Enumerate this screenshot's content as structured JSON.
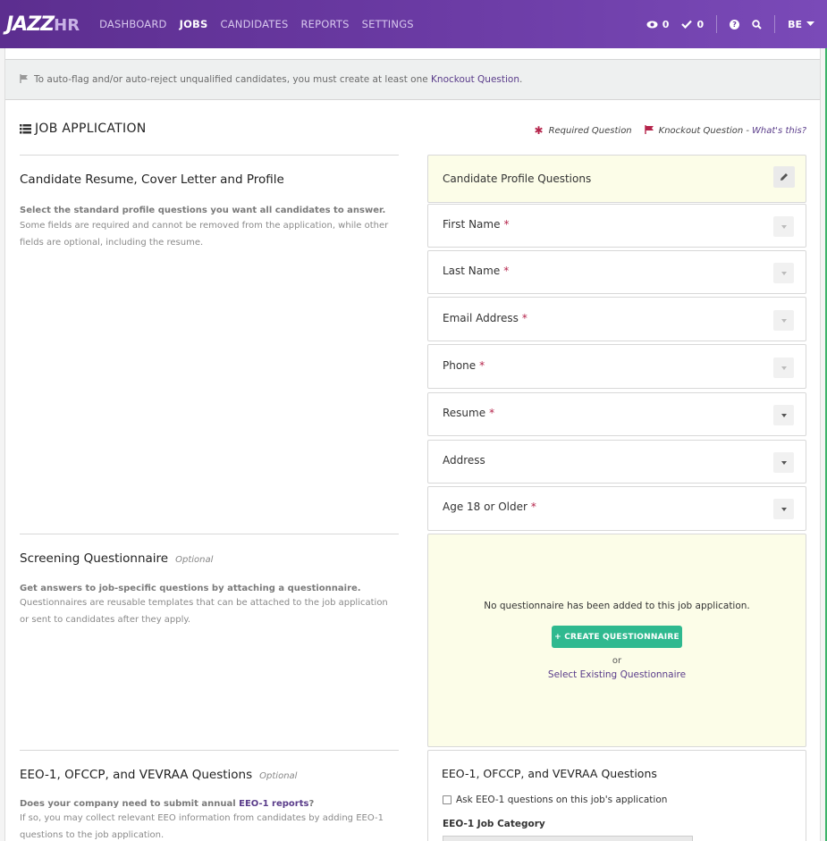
{
  "nav": {
    "logo_main": "JAZZ",
    "logo_hr": "HR",
    "links": [
      "DASHBOARD",
      "JOBS",
      "CANDIDATES",
      "REPORTS",
      "SETTINGS"
    ],
    "active": "JOBS",
    "views_count": "0",
    "checks_count": "0",
    "user_initials": "BE"
  },
  "banner": {
    "text": "To auto-flag and/or auto-reject unqualified candidates, you must create at least one ",
    "link": "Knockout Question",
    "suffix": "."
  },
  "page": {
    "title": "JOB APPLICATION",
    "legend_required": "Required Question",
    "legend_knockout": "Knockout Question - ",
    "legend_whats_this": "What's this?"
  },
  "sections": {
    "profile": {
      "title": "Candidate Resume, Cover Letter and Profile",
      "bold": "Select the standard profile questions you want all candidates to answer.",
      "text": "Some fields are required and cannot be removed from the application, while other fields are optional, including the resume."
    },
    "screening": {
      "title": "Screening Questionnaire",
      "optional": "Optional",
      "bold": "Get answers to job-specific questions by attaching a questionnaire.",
      "text": "Questionnaires are reusable templates that can be attached to the job application or sent to candidates after they apply."
    },
    "eeo": {
      "title": "EEO-1, OFCCP, and VEVRAA Questions",
      "optional": "Optional",
      "bold_prefix": "Does your company need to submit annual ",
      "bold_link": "EEO-1 reports",
      "bold_suffix": "?",
      "text": "If so, you may collect relevant EEO information from candidates by adding EEO-1 questions to the job application."
    }
  },
  "profile_card": {
    "header": "Candidate Profile Questions",
    "rows": [
      {
        "label": "First Name",
        "required": "*"
      },
      {
        "label": "Last Name",
        "required": "*"
      },
      {
        "label": "Email Address",
        "required": "*"
      },
      {
        "label": "Phone",
        "required": "*"
      },
      {
        "label": "Resume",
        "required": "*"
      },
      {
        "label": "Address",
        "required": ""
      },
      {
        "label": "Age 18 or Older",
        "required": "*"
      }
    ]
  },
  "questionnaire_card": {
    "empty_text": "No questionnaire has been added to this job application.",
    "create_button": "+ CREATE QUESTIONNAIRE",
    "or": "or",
    "select_link": "Select Existing Questionnaire"
  },
  "eeo_card": {
    "title": "EEO-1, OFCCP, and VEVRAA Questions",
    "checkbox_label": "Ask EEO-1 questions on this job's application",
    "job_category_label": "EEO-1 Job Category"
  }
}
